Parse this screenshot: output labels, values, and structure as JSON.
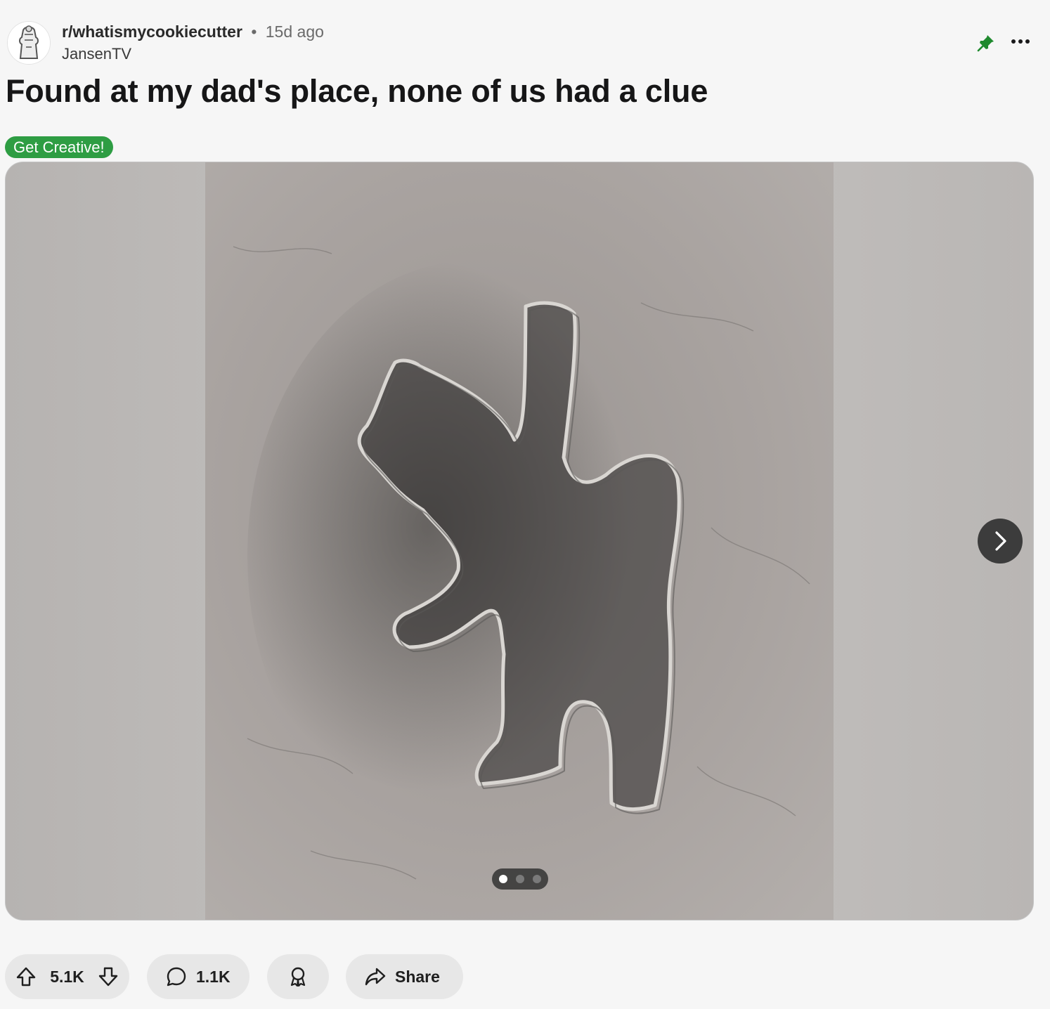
{
  "post": {
    "subreddit": "r/whatismycookiecutter",
    "separator": "•",
    "age": "15d ago",
    "author": "JansenTV",
    "title": "Found at my dad's place, none of us had a clue",
    "flair": "Get Creative!",
    "flair_color": "#2e9d43"
  },
  "header_icons": {
    "pin": "pin-icon",
    "more": "more-options-icon",
    "pin_color": "#1f8a2e"
  },
  "gallery": {
    "image_description": "metal cookie cutter on stone surface",
    "slide_count": 3,
    "current_slide": 1,
    "next_icon": "chevron-right-icon"
  },
  "actions": {
    "upvote_icon": "upvote-arrow-icon",
    "vote_count": "5.1K",
    "downvote_icon": "downvote-arrow-icon",
    "comment_icon": "comment-bubble-icon",
    "comment_count": "1.1K",
    "award_icon": "award-icon",
    "share_icon": "share-arrow-icon",
    "share_label": "Share"
  }
}
